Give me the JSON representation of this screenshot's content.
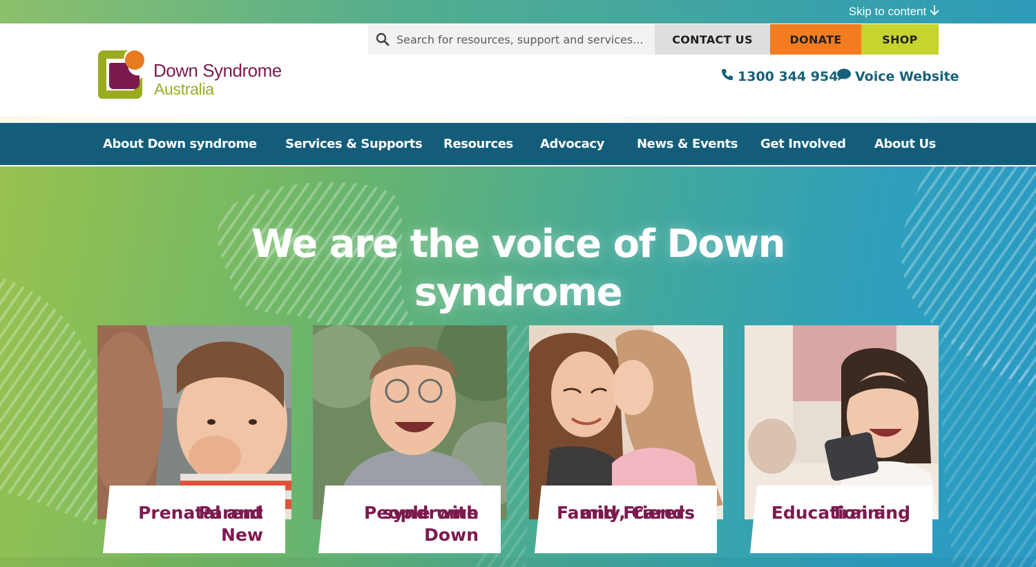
{
  "skip_link": {
    "label": "Skip to content"
  },
  "logo": {
    "line1": "Down Syndrome",
    "line2": "Australia"
  },
  "search": {
    "placeholder": "Search for resources, support and services..."
  },
  "header_buttons": {
    "contact": "CONTACT US",
    "donate": "DONATE",
    "shop": "SHOP"
  },
  "contact": {
    "phone": "1300 344 954",
    "voice": "Voice Website"
  },
  "nav": {
    "items": [
      {
        "label": "About Down syndrome"
      },
      {
        "label": "Services & Supports"
      },
      {
        "label": "Resources"
      },
      {
        "label": "Advocacy"
      },
      {
        "label": "News & Events"
      },
      {
        "label": "Get Involved"
      },
      {
        "label": "About Us"
      }
    ]
  },
  "hero": {
    "title_line1": "We are the voice of Down",
    "title_line2": "syndrome"
  },
  "cards": [
    {
      "label_line1": "Prenatal and New",
      "label_line2": "Parent"
    },
    {
      "label_line1": "People with Down",
      "label_line2": "syndrome"
    },
    {
      "label_line1": "Family, Carers",
      "label_line2": "and Friends"
    },
    {
      "label_line1": "Education and",
      "label_line2": "Training"
    }
  ],
  "colors": {
    "brand_maroon": "#7c1a4f",
    "brand_green": "#9aab22",
    "nav_blue": "#135d7a",
    "donate_orange": "#f47c20",
    "shop_lime": "#c5d42f",
    "link_teal": "#16607a"
  },
  "icons": {
    "skip": "arrow-down-icon",
    "search": "search-icon",
    "phone": "phone-icon",
    "voice": "chat-bubble-icon"
  }
}
